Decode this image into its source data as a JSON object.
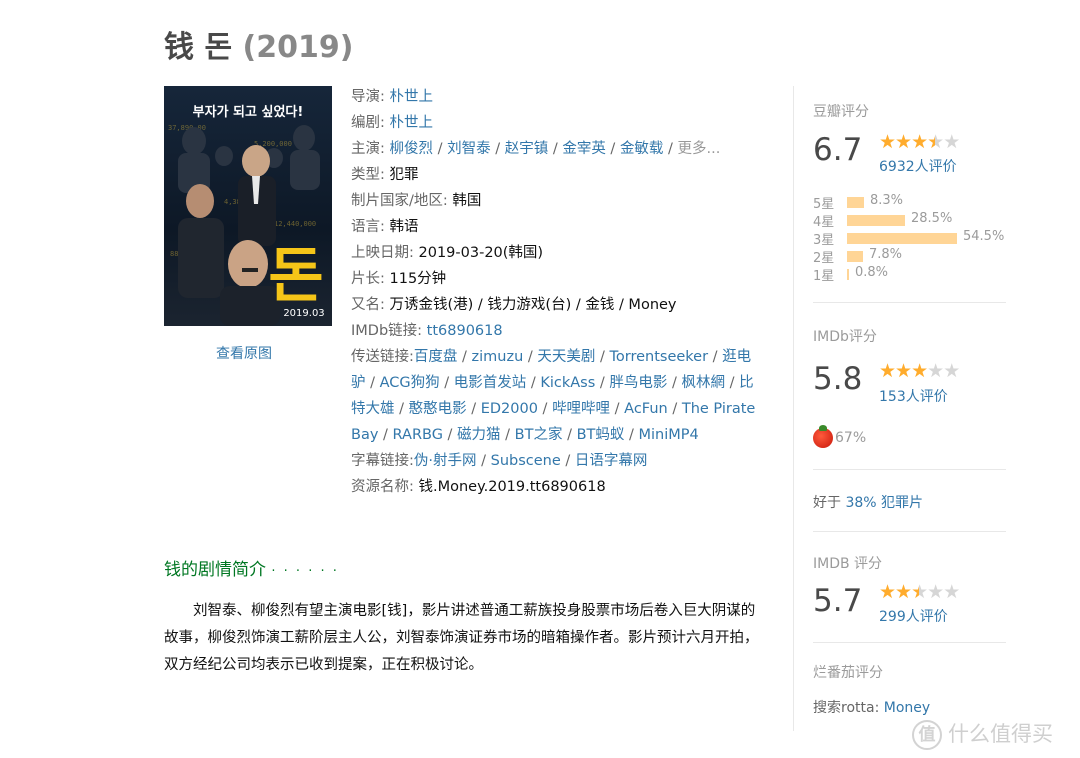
{
  "title": {
    "main": "钱 돈",
    "year": "(2019)"
  },
  "poster": {
    "tagline": "부자가 되고 싶었다!",
    "big_char": "돈",
    "date": "2019.03"
  },
  "view_original": "查看原图",
  "info": {
    "director": {
      "label": "导演: ",
      "names": [
        "朴世上"
      ]
    },
    "writer": {
      "label": "编剧: ",
      "names": [
        "朴世上"
      ]
    },
    "cast": {
      "label": "主演: ",
      "names": [
        "柳俊烈",
        "刘智泰",
        "赵宇镇",
        "金宰英",
        "金敏载"
      ],
      "more": "更多..."
    },
    "genre": {
      "label": "类型: ",
      "value": "犯罪"
    },
    "country": {
      "label": "制片国家/地区: ",
      "value": "韩国"
    },
    "language": {
      "label": "语言: ",
      "value": "韩语"
    },
    "release": {
      "label": "上映日期: ",
      "value": "2019-03-20(韩国)"
    },
    "runtime": {
      "label": "片长: ",
      "value": "115分钟"
    },
    "aka": {
      "label": "又名: ",
      "value": "万诱金钱(港) / 钱力游戏(台) / 金钱 / Money"
    },
    "imdb": {
      "label": "IMDb链接: ",
      "value": "tt6890618"
    },
    "links": {
      "label": "传送链接:",
      "items": [
        "百度盘",
        "zimuzu",
        "天天美剧",
        "Torrentseeker",
        "逛电驴",
        "ACG狗狗",
        "电影首发站",
        "KickAss",
        "胖鸟电影",
        "枫林網",
        "比特大雄",
        "憨憨电影",
        "ED2000",
        "哔哩哔哩",
        "AcFun",
        "The Pirate Bay",
        "RARBG",
        "磁力猫",
        "BT之家",
        "BT蚂蚁",
        "MiniMP4"
      ]
    },
    "subs": {
      "label": "字幕链接:",
      "items": [
        "伪·射手网",
        "Subscene",
        "日语字幕网"
      ]
    },
    "resource": {
      "label": "资源名称: ",
      "value": "钱.Money.2019.tt6890618"
    }
  },
  "synopsis": {
    "heading": "钱的剧情简介",
    "dots": "· · · · · ·",
    "text": "刘智泰、柳俊烈有望主演电影[钱]，影片讲述普通工薪族投身股票市场后卷入巨大阴谋的故事，柳俊烈饰演工薪阶层主人公，刘智泰饰演证券市场的暗箱操作者。影片预计六月开拍，双方经纪公司均表示已收到提案，正在积极讨论。"
  },
  "douban": {
    "label": "豆瓣评分",
    "score": "6.7",
    "stars": 3.5,
    "count": "6932人评价",
    "dist": [
      {
        "star": "5星",
        "pct": "8.3%",
        "value": 8.3
      },
      {
        "star": "4星",
        "pct": "28.5%",
        "value": 28.5
      },
      {
        "star": "3星",
        "pct": "54.5%",
        "value": 54.5
      },
      {
        "star": "2星",
        "pct": "7.8%",
        "value": 7.8
      },
      {
        "star": "1星",
        "pct": "0.8%",
        "value": 0.8
      }
    ]
  },
  "imdb1": {
    "label": "IMDb评分",
    "score": "5.8",
    "stars": 3,
    "count": "153人评价"
  },
  "tomato": {
    "value": "67%"
  },
  "better": {
    "prefix": "好于 ",
    "pct": "38% 犯罪片"
  },
  "imdb2": {
    "label": "IMDB 评分",
    "score": "5.7",
    "stars": 2.5,
    "count": "299人评价"
  },
  "rt": {
    "label": "烂番茄评分",
    "search_label": "搜索rotta: ",
    "search_link": "Money"
  },
  "watermark": {
    "logo": "值",
    "text": "什么值得买"
  },
  "colors": {
    "link": "#3377aa",
    "green_heading": "#007722",
    "star": "#ffac2d",
    "bar": "#ffd596"
  }
}
